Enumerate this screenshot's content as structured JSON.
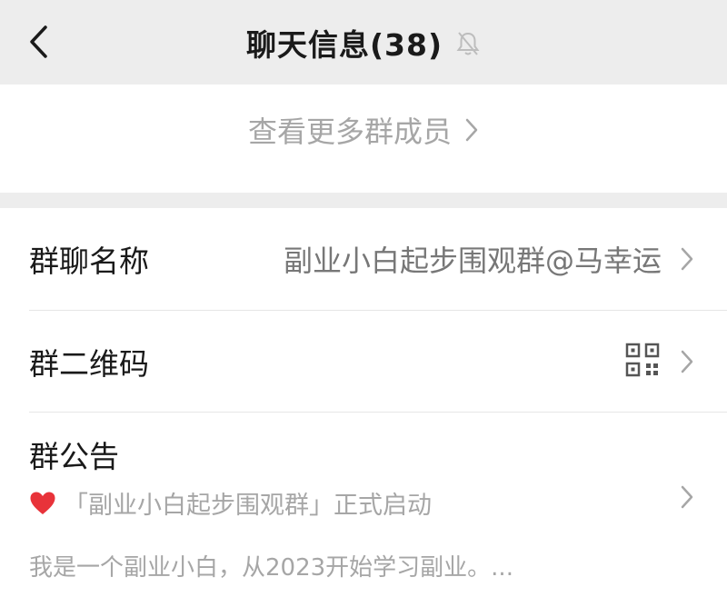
{
  "header": {
    "title": "聊天信息(38)",
    "muted_icon": "bell-off-icon",
    "back_icon": "chevron-left-icon"
  },
  "members": {
    "more_label": "查看更多群成员"
  },
  "settings": {
    "group_name_label": "群聊名称",
    "group_name_value": "副业小白起步围观群@马幸运",
    "qr_code_label": "群二维码",
    "qr_icon": "qr-code-icon",
    "announcement_label": "群公告",
    "announcement_emoji": "❤️",
    "announcement_headline": "「副业小白起步围观群」正式启动",
    "announcement_preview": "我是一个副业小白，从2023开始学习副业。..."
  },
  "colors": {
    "background": "#ededed",
    "surface": "#ffffff",
    "text_primary": "#1a1a1a",
    "text_secondary": "#a6a6a6",
    "heart": "#e8333a"
  }
}
